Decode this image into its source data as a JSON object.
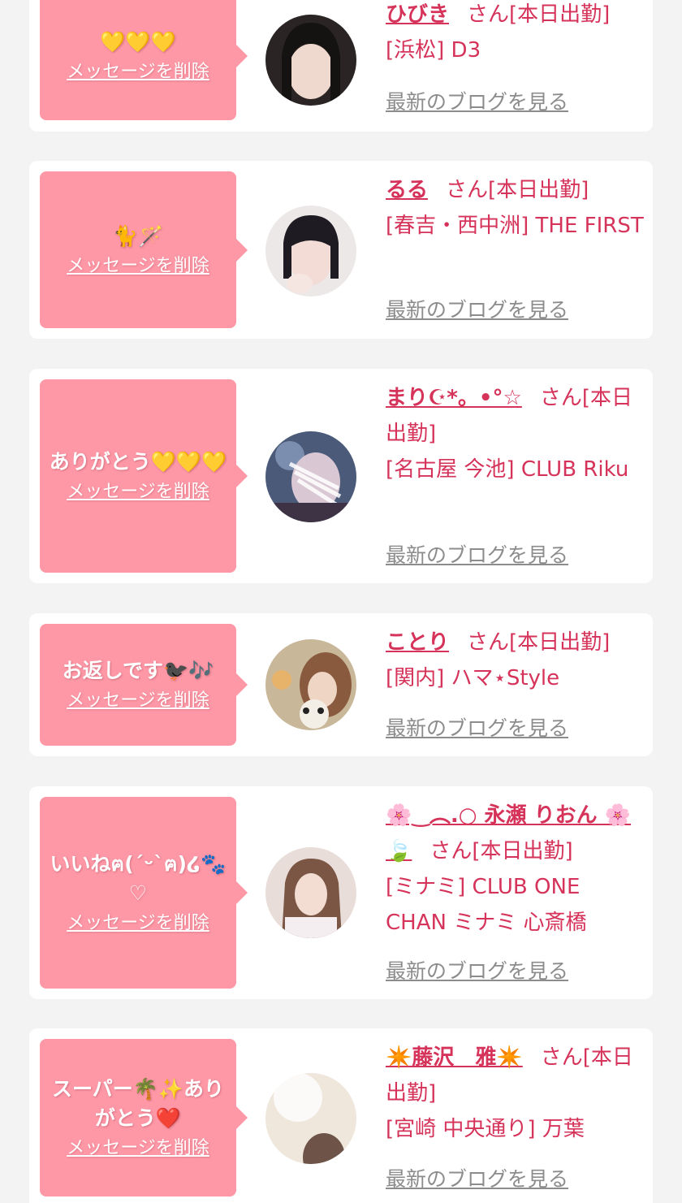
{
  "theme": {
    "accent": "#d6335a",
    "bubble": "#ff98a6",
    "card": "#ffffff",
    "background": "#f3f3f3",
    "muted": "#8c8c8c"
  },
  "delete_label": "メッセージを削除",
  "blog_label": "最新のブログを見る",
  "items": [
    {
      "message": "💛💛💛",
      "name": "ひびき",
      "suffix": "さん[本日出勤]",
      "shop": "[浜松] D3"
    },
    {
      "message": "🐈🪄",
      "name": "るる",
      "suffix": "さん[本日出勤]",
      "shop": "[春吉・西中洲] THE FIRST"
    },
    {
      "message": "ありがとう💛💛💛",
      "name": "まり☪︎*。•°☆",
      "suffix": "さん[本日出勤]",
      "shop": "[名古屋 今池] CLUB Riku"
    },
    {
      "message": "お返しです🐦‍⬛🎶",
      "name": "ことり",
      "suffix": "さん[本日出勤]",
      "shop": "[関内] ハマ⋆Style"
    },
    {
      "message": "いいねฅ(´ᵕ`ฅ)໒🐾♡",
      "name": "🌸‿︵.○ 永瀬 りおん 🌸🍃",
      "suffix": "さん[本日出勤]",
      "shop": "[ミナミ] CLUB ONE CHAN ミナミ 心斎橋"
    },
    {
      "message": "スーパー🌴✨ありがとう❤️",
      "name": "✴️藤沢　雅✴️",
      "suffix": "さん[本日出勤]",
      "shop": "[宮崎 中央通り] 万葉"
    }
  ]
}
